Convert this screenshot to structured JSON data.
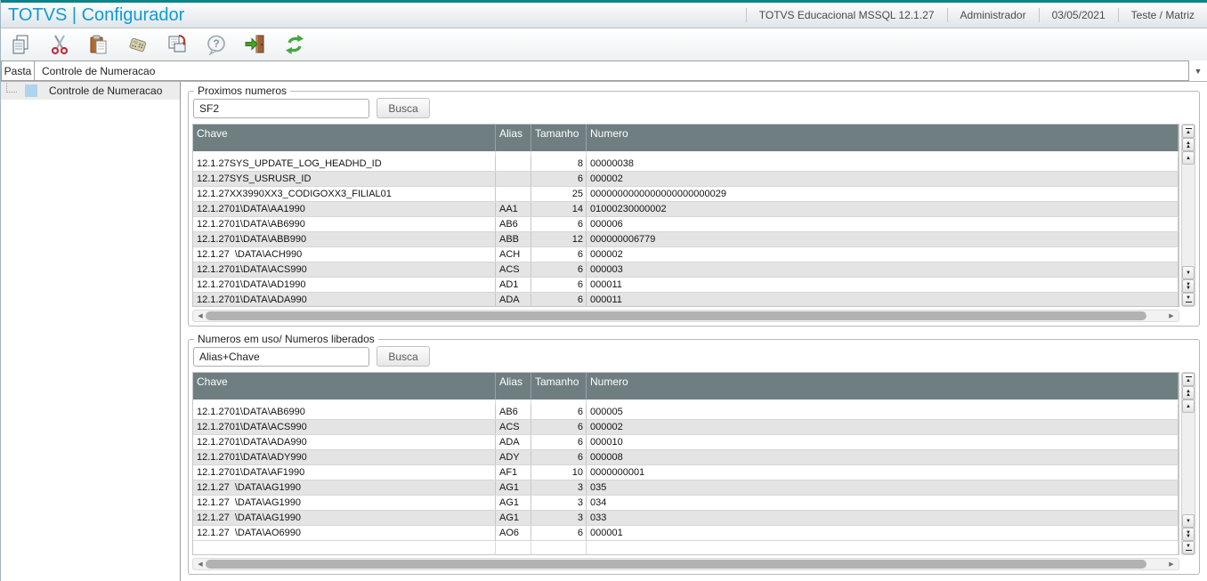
{
  "app": {
    "title": "TOTVS | Configurador",
    "environment": "TOTVS Educacional MSSQL 12.1.27",
    "user": "Administrador",
    "date": "03/05/2021",
    "company": "Teste / Matriz"
  },
  "toolbar": {
    "buttons": [
      {
        "name": "copy",
        "icon": "copy-icon"
      },
      {
        "name": "cut",
        "icon": "cut-icon"
      },
      {
        "name": "paste",
        "icon": "paste-icon"
      },
      {
        "name": "calculator",
        "icon": "calculator-icon"
      },
      {
        "name": "print-copies",
        "icon": "print-copies-icon"
      },
      {
        "name": "help",
        "icon": "help-icon"
      },
      {
        "name": "exit",
        "icon": "exit-door-icon"
      },
      {
        "name": "refresh",
        "icon": "refresh-icon"
      }
    ]
  },
  "folder_bar": {
    "label": "Pasta",
    "selected": "Controle de Numeracao"
  },
  "tree": {
    "items": [
      {
        "label": "Controle de Numeracao",
        "selected": true
      }
    ]
  },
  "panels": [
    {
      "legend": "Proximos numeros",
      "search_value": "SF2",
      "search_button": "Busca",
      "columns": [
        "Chave",
        "Alias",
        "Tamanho",
        "Numero"
      ],
      "rows": [
        [
          "12.1.27SYS_UPDATE_LOG_HEADHD_ID",
          "",
          "8",
          "00000038"
        ],
        [
          "12.1.27SYS_USRUSR_ID",
          "",
          "6",
          "000002"
        ],
        [
          "12.1.27XX3990XX3_CODIGOXX3_FILIAL01",
          "",
          "25",
          "0000000000000000000000029"
        ],
        [
          "12.1.2701\\DATA\\AA1990",
          "AA1",
          "14",
          "01000230000002"
        ],
        [
          "12.1.2701\\DATA\\AB6990",
          "AB6",
          "6",
          "000006"
        ],
        [
          "12.1.2701\\DATA\\ABB990",
          "ABB",
          "12",
          "000000006779"
        ],
        [
          "12.1.27  \\DATA\\ACH990",
          "ACH",
          "6",
          "000002"
        ],
        [
          "12.1.2701\\DATA\\ACS990",
          "ACS",
          "6",
          "000003"
        ],
        [
          "12.1.2701\\DATA\\AD1990",
          "AD1",
          "6",
          "000011"
        ],
        [
          "12.1.2701\\DATA\\ADA990",
          "ADA",
          "6",
          "000011"
        ]
      ]
    },
    {
      "legend": "Numeros em uso/ Numeros liberados",
      "search_value": "Alias+Chave",
      "search_button": "Busca",
      "columns": [
        "Chave",
        "Alias",
        "Tamanho",
        "Numero"
      ],
      "rows": [
        [
          "12.1.2701\\DATA\\AB6990",
          "AB6",
          "6",
          "000005"
        ],
        [
          "12.1.2701\\DATA\\ACS990",
          "ACS",
          "6",
          "000002"
        ],
        [
          "12.1.2701\\DATA\\ADA990",
          "ADA",
          "6",
          "000010"
        ],
        [
          "12.1.2701\\DATA\\ADY990",
          "ADY",
          "6",
          "000008"
        ],
        [
          "12.1.2701\\DATA\\AF1990",
          "AF1",
          "10",
          "0000000001"
        ],
        [
          "12.1.27  \\DATA\\AG1990",
          "AG1",
          "3",
          "035"
        ],
        [
          "12.1.27  \\DATA\\AG1990",
          "AG1",
          "3",
          "034"
        ],
        [
          "12.1.27  \\DATA\\AG1990",
          "AG1",
          "3",
          "033"
        ],
        [
          "12.1.27  \\DATA\\AO6990",
          "AO6",
          "6",
          "000001"
        ]
      ]
    }
  ],
  "colors": {
    "top_border": "#0b8488",
    "title_accent": "#0f9bd6",
    "grid_header_bg": "#6f7e80",
    "row_alt_bg": "#e4e4e4"
  }
}
